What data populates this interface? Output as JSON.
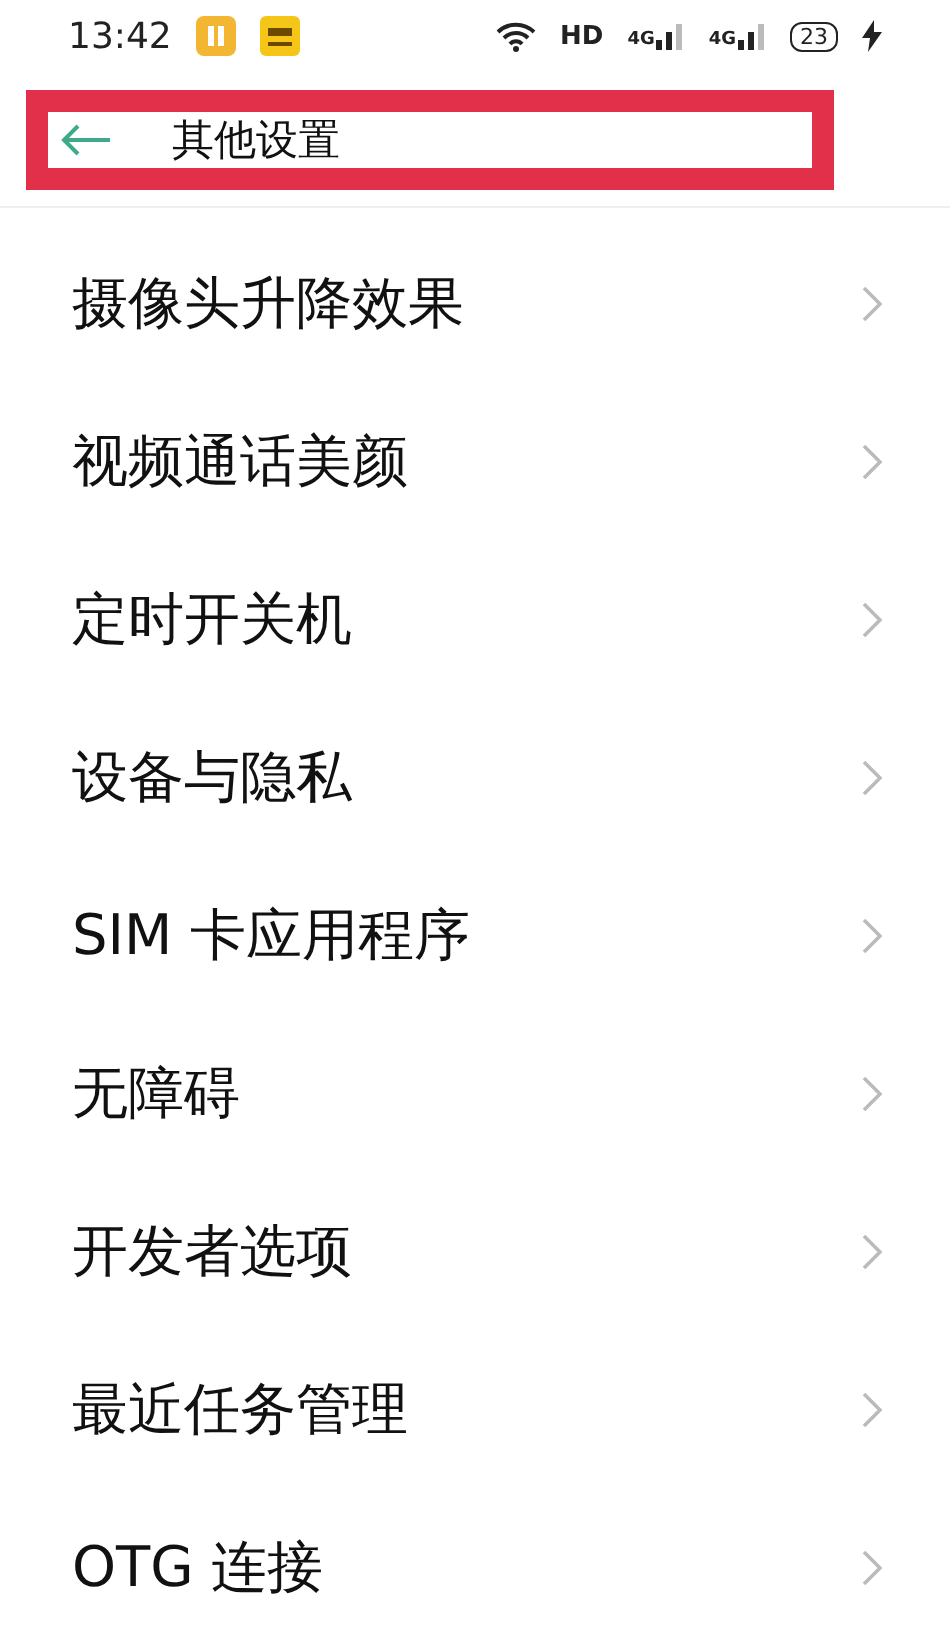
{
  "status_bar": {
    "time": "13:42",
    "network_label": "HD",
    "signal_labels": [
      "4G",
      "4G"
    ],
    "battery": "23",
    "charging": true
  },
  "header": {
    "title": "其他设置",
    "highlighted": true
  },
  "items": [
    {
      "label": "摄像头升降效果"
    },
    {
      "label": "视频通话美颜"
    },
    {
      "label": "定时开关机"
    },
    {
      "label": "设备与隐私"
    },
    {
      "label": "SIM 卡应用程序"
    },
    {
      "label": "无障碍"
    },
    {
      "label": "开发者选项"
    },
    {
      "label": "最近任务管理"
    },
    {
      "label": "OTG 连接"
    }
  ]
}
